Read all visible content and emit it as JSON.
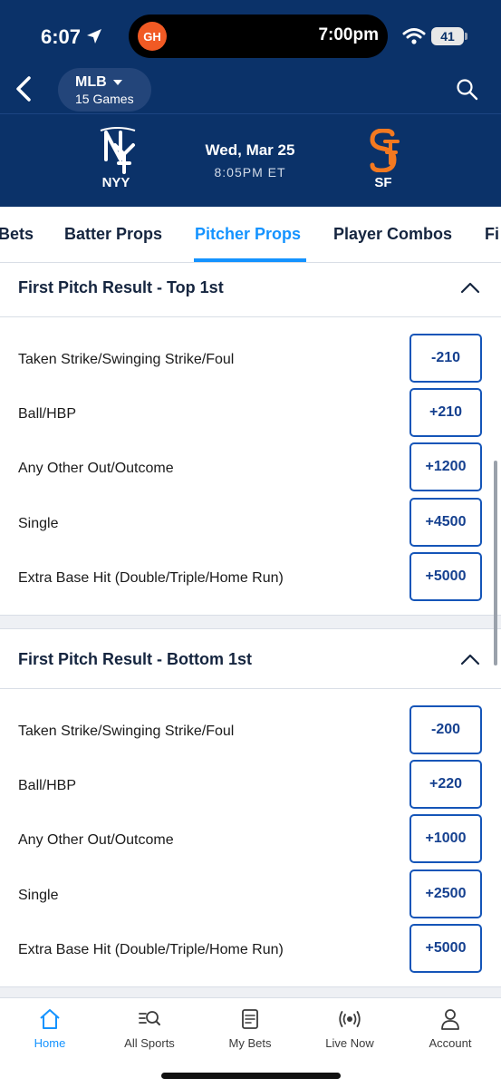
{
  "status": {
    "time": "6:07",
    "island_app_badge": "GH",
    "island_time": "7:00pm",
    "battery": "41"
  },
  "nav_header": {
    "league": "MLB",
    "games": "15 Games"
  },
  "game": {
    "away_team": "NYY",
    "home_team": "SF",
    "date": "Wed, Mar 25",
    "time": "8:05PM ET",
    "away_logo_icon": "yankees-logo-icon",
    "home_logo_icon": "giants-logo-icon"
  },
  "tabs": [
    {
      "label": "Bets"
    },
    {
      "label": "Batter Props"
    },
    {
      "label": "Pitcher Props"
    },
    {
      "label": "Player Combos"
    },
    {
      "label": "Fi"
    }
  ],
  "sections": [
    {
      "title": "First Pitch Result - Top 1st",
      "rows": [
        {
          "label": "Taken Strike/Swinging Strike/Foul",
          "odds": "-210"
        },
        {
          "label": "Ball/HBP",
          "odds": "+210"
        },
        {
          "label": "Any Other Out/Outcome",
          "odds": "+1200"
        },
        {
          "label": "Single",
          "odds": "+4500"
        },
        {
          "label": "Extra Base Hit (Double/Triple/Home Run)",
          "odds": "+5000"
        }
      ]
    },
    {
      "title": "First Pitch Result - Bottom 1st",
      "rows": [
        {
          "label": "Taken Strike/Swinging Strike/Foul",
          "odds": "-200"
        },
        {
          "label": "Ball/HBP",
          "odds": "+220"
        },
        {
          "label": "Any Other Out/Outcome",
          "odds": "+1000"
        },
        {
          "label": "Single",
          "odds": "+2500"
        },
        {
          "label": "Extra Base Hit (Double/Triple/Home Run)",
          "odds": "+5000"
        }
      ]
    }
  ],
  "bottom_nav": [
    {
      "label": "Home",
      "icon": "home-icon",
      "active": true
    },
    {
      "label": "All Sports",
      "icon": "search-list-icon"
    },
    {
      "label": "My Bets",
      "icon": "bet-slip-icon"
    },
    {
      "label": "Live Now",
      "icon": "live-broadcast-icon"
    },
    {
      "label": "Account",
      "icon": "account-icon"
    }
  ],
  "colors": {
    "header_bg": "#0b3269",
    "accent": "#1493ff",
    "odds_border": "#1555b8"
  }
}
